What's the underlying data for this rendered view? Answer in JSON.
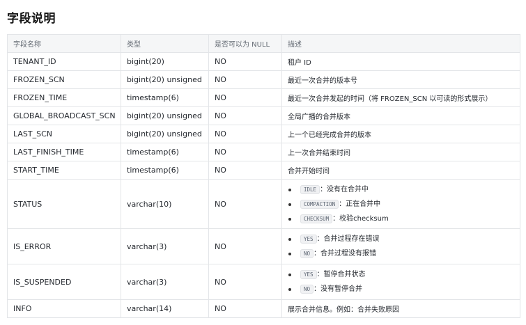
{
  "page": {
    "title": "字段说明"
  },
  "table": {
    "headers": [
      "字段名称",
      "类型",
      "是否可以为 NULL",
      "描述"
    ],
    "rows": [
      {
        "name": "TENANT_ID",
        "type": "bigint(20)",
        "nullable": "NO",
        "desc": "租户 ID"
      },
      {
        "name": "FROZEN_SCN",
        "type": "bigint(20) unsigned",
        "nullable": "NO",
        "desc": "最近一次合并的版本号"
      },
      {
        "name": "FROZEN_TIME",
        "type": "timestamp(6)",
        "nullable": "NO",
        "desc": "最近一次合并发起的时间（将 FROZEN_SCN 以可读的形式展示）"
      },
      {
        "name": "GLOBAL_BROADCAST_SCN",
        "type": "bigint(20) unsigned",
        "nullable": "NO",
        "desc": "全局广播的合并版本"
      },
      {
        "name": "LAST_SCN",
        "type": "bigint(20) unsigned",
        "nullable": "NO",
        "desc": "上一个已经完成合并的版本"
      },
      {
        "name": "LAST_FINISH_TIME",
        "type": "timestamp(6)",
        "nullable": "NO",
        "desc": "上一次合并结束时间"
      },
      {
        "name": "START_TIME",
        "type": "timestamp(6)",
        "nullable": "NO",
        "desc": "合并开始时间"
      },
      {
        "name": "STATUS",
        "type": "varchar(10)",
        "nullable": "NO",
        "items": [
          {
            "code": "IDLE",
            "text": "：没有在合并中"
          },
          {
            "code": "COMPACTION",
            "text": "：正在合并中"
          },
          {
            "code": "CHECKSUM",
            "text": "：校验checksum"
          }
        ]
      },
      {
        "name": "IS_ERROR",
        "type": "varchar(3)",
        "nullable": "NO",
        "items": [
          {
            "code": "YES",
            "text": "：合并过程存在错误"
          },
          {
            "code": "NO",
            "text": "：合并过程没有报错"
          }
        ]
      },
      {
        "name": "IS_SUSPENDED",
        "type": "varchar(3)",
        "nullable": "NO",
        "items": [
          {
            "code": "YES",
            "text": "：暂停合并状态"
          },
          {
            "code": "NO",
            "text": "：没有暂停合并"
          }
        ]
      },
      {
        "name": "INFO",
        "type": "varchar(14)",
        "nullable": "NO",
        "desc": "展示合并信息。例如：合并失败原因"
      }
    ]
  }
}
